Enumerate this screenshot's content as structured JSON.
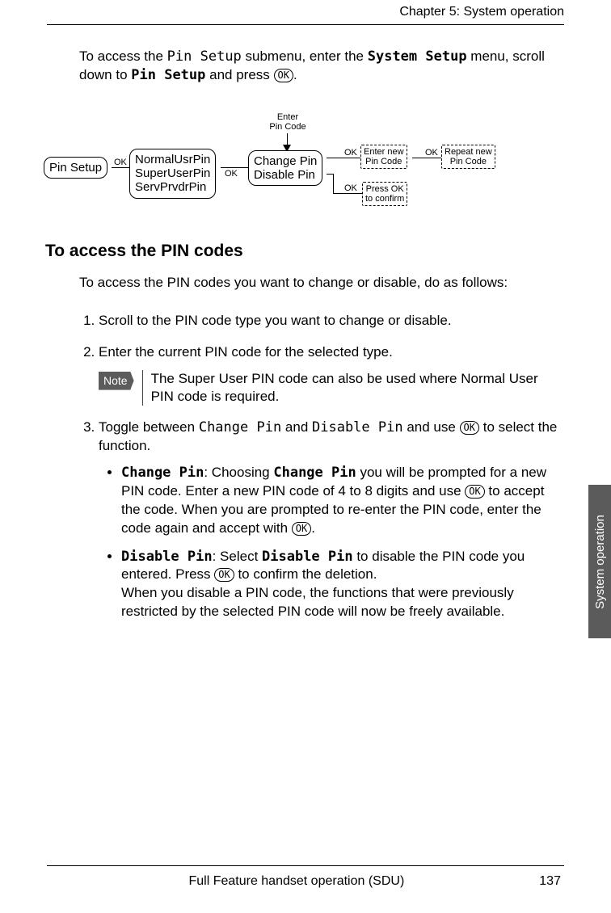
{
  "header": {
    "chapter": "Chapter 5:  System operation"
  },
  "intro": {
    "t1": "To access the ",
    "t2": "Pin Setup",
    "t3": " submenu, enter the ",
    "t4": "System Setup",
    "t5": " menu, scroll down to ",
    "t6": "Pin Setup",
    "t7": " and press "
  },
  "ok": "OK",
  "diagram": {
    "enter_label_l1": "Enter",
    "enter_label_l2": "Pin Code",
    "pin_setup": "Pin Setup",
    "normal": "NormalUsrPin",
    "super": "SuperUserPin",
    "serv": "ServPrvdrPin",
    "change": "Change Pin",
    "disable": "Disable Pin",
    "enter_new_l1": "Enter new",
    "enter_new_l2": "Pin Code",
    "repeat_new_l1": "Repeat new",
    "repeat_new_l2": "Pin Code",
    "press_ok_l1": "Press OK",
    "press_ok_l2": "to confirm",
    "ok_small": "OK"
  },
  "section": {
    "heading": "To access the PIN codes",
    "intro": "To access the PIN codes you want to change or disable, do as follows:"
  },
  "steps": {
    "s1": "Scroll to the PIN code type you want to change or disable.",
    "s2": "Enter the current PIN code for the selected type.",
    "note_label": "Note",
    "note_text": "The Super User PIN code can also be used where Normal User PIN code is required.",
    "s3a": "Toggle between ",
    "s3b": "Change Pin",
    "s3c": " and ",
    "s3d": "Disable Pin",
    "s3e": " and use ",
    "s3f": " to select the function.",
    "b1a": "Change Pin",
    "b1b": ": Choosing ",
    "b1c": "Change Pin",
    "b1d": " you will be prompted for a new PIN code. Enter a new PIN code of 4 to 8 digits and use ",
    "b1e": " to accept the code. When you are prompted to re-enter the PIN code, enter the code again and accept with ",
    "b1f": ".",
    "b2a": "Disable Pin",
    "b2b": ": Select ",
    "b2c": "Disable Pin",
    "b2d": " to disable the PIN code you entered. Press ",
    "b2e": " to confirm the deletion.",
    "b2f": "When you disable a PIN code, the functions that were previously restricted by the selected PIN code will now be freely available."
  },
  "side_tab": "System operation",
  "footer": {
    "title": "Full Feature handset operation (SDU)",
    "page": "137"
  }
}
